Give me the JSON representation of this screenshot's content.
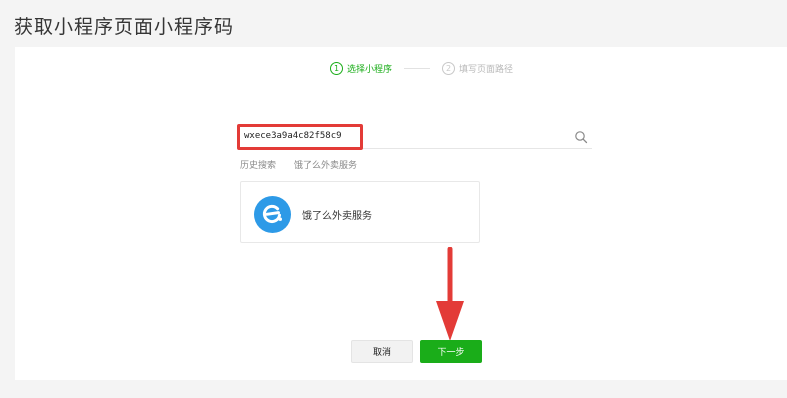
{
  "page": {
    "title": "获取小程序页面小程序码"
  },
  "steps": [
    {
      "num": "1",
      "label": "选择小程序"
    },
    {
      "num": "2",
      "label": "填写页面路径"
    }
  ],
  "search": {
    "value": "wxece3a9a4c82f58c9",
    "icon": "search-icon"
  },
  "history": {
    "label": "历史搜索",
    "item": "饿了么外卖服务"
  },
  "result": {
    "name": "饿了么外卖服务",
    "logo": "eleme-logo"
  },
  "buttons": {
    "cancel": "取消",
    "next": "下一步"
  },
  "colors": {
    "accent": "#1aad19",
    "highlight": "#e33b37",
    "logo_blue": "#2d9ae7"
  }
}
